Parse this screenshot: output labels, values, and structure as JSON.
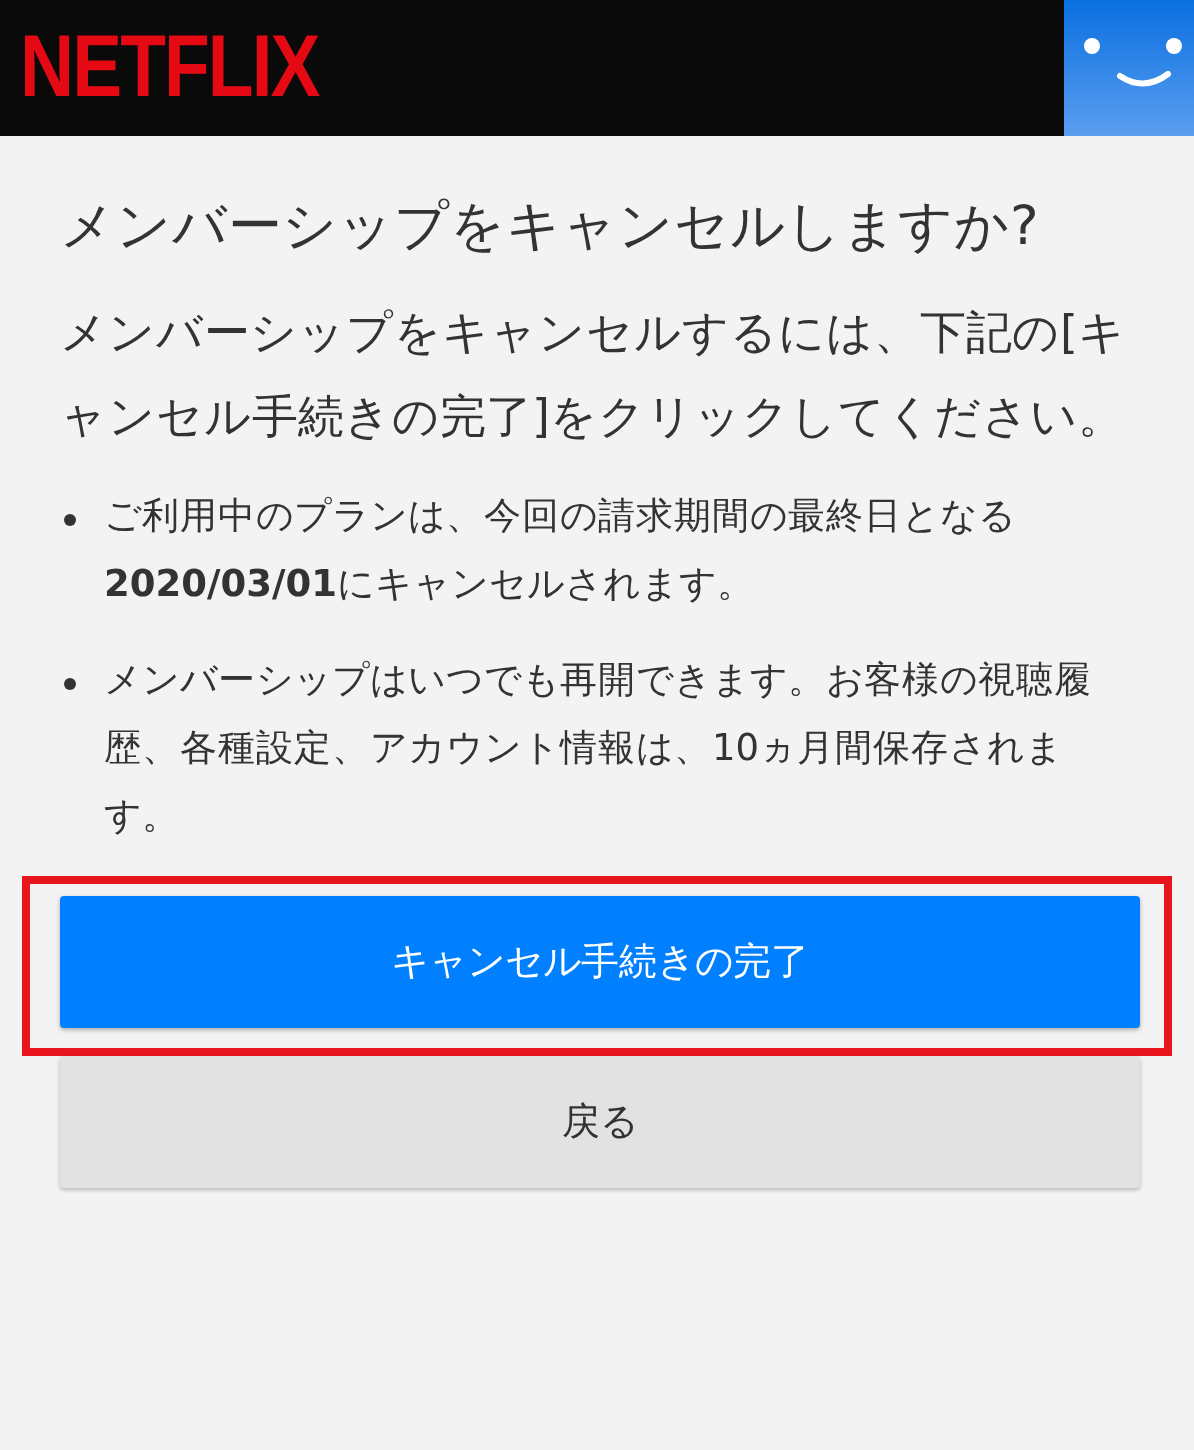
{
  "header": {
    "logo": "NETFLIX"
  },
  "title": "メンバーシップをキャンセルしますか?",
  "description": "メンバーシップをキャンセルするには、下記の[キャンセル手続きの完了]をクリックしてください。",
  "notes": [
    "ご利用中のプランは、今回の請求期間の最終日となる**2020/03/01**にキャンセルされます。",
    "メンバーシップはいつでも再開できます。お客様の視聴履歴、各種設定、アカウント情報は、10ヵ月間保存されます。"
  ],
  "buttons": [
    {
      "kind": "primary",
      "label": "キャンセル手続きの完了",
      "highlighted": true
    },
    {
      "kind": "secondary",
      "label": "戻る",
      "highlighted": false
    }
  ]
}
